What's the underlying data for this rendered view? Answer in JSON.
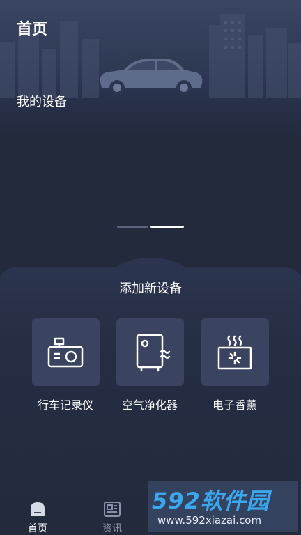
{
  "header": {
    "title": "首页",
    "section_label": "我的设备"
  },
  "pager": {
    "pages": 2,
    "current": 2
  },
  "add_panel": {
    "title": "添加新设备",
    "devices": [
      {
        "label": "行车记录仪",
        "icon": "dashcam-icon"
      },
      {
        "label": "空气净化器",
        "icon": "air-purifier-icon"
      },
      {
        "label": "电子香薰",
        "icon": "aroma-diffuser-icon"
      }
    ]
  },
  "tabbar": {
    "tabs": [
      {
        "label": "首页",
        "icon": "home-icon",
        "active": true
      },
      {
        "label": "资讯",
        "icon": "news-icon",
        "active": false
      }
    ]
  },
  "watermark": {
    "brand": "592软件园",
    "url": "www.592xiazai.com"
  },
  "colors": {
    "background": "#222a3c",
    "card": "#3a4460",
    "accent_brand": "#3aa8f0",
    "inactive_tab": "#8a93aa"
  }
}
